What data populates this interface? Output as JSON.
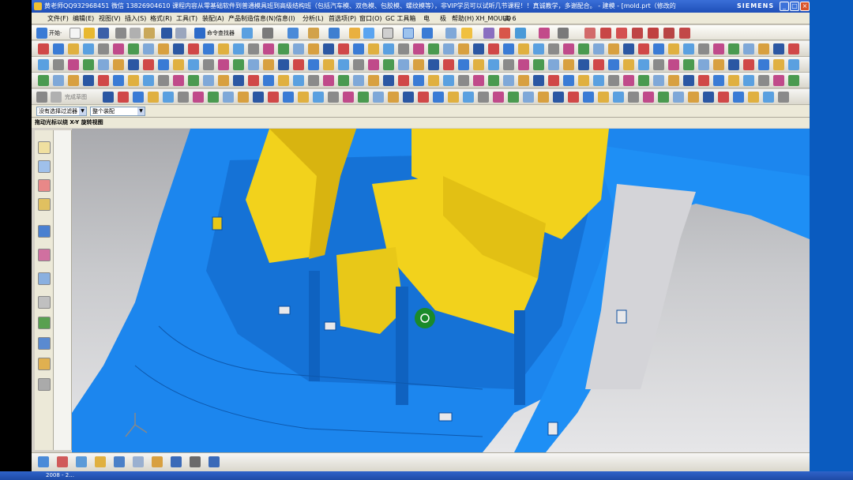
{
  "window": {
    "title": "黄老师QQ932968451 微信 13826904610 课程内容从零基础软件到普通模具班到高级结构班（包括汽车模、双色模、包胶模、螺纹模等），非VIP学员可以试听几节课程！！真诚教学，多谢配合。 - 建模 - [mold.prt（修改的）]",
    "brand": "SIEMENS",
    "buttons": [
      "_",
      "□",
      "×"
    ]
  },
  "menu": [
    "文件(F)",
    "编辑(E)",
    "视图(V)",
    "插入(S)",
    "格式(R)",
    "工具(T)",
    "装配(A)",
    "产品制造信息(N)",
    "信息(I)",
    "分析(L)",
    "首选项(P)",
    "窗口(O)",
    "GC 工具箱",
    "电",
    "极",
    "帮助(H)",
    "XH_MOULD",
    "高 6"
  ],
  "toolbar_labels": {
    "start": "开始·",
    "command_finder": "命令查找器",
    "finish_sketch": "完成草图"
  },
  "selection": {
    "filter": "没有选择过滤器",
    "scope": "整个装配"
  },
  "cue_line": "拖动光标以绕 X-Y 旋转视图",
  "taskbar_text": "2008 - 2...",
  "colors": {
    "part_blue": "#1f8ff0",
    "insert_yellow": "#f2d21c",
    "background_top": "#a9aaae",
    "title_blue": "#2a5fcc",
    "rotate_marker": "#1a8a2a"
  },
  "view": {
    "rotate_icon": "rotate-cursor-icon",
    "triad": "wcs-triad-icon"
  }
}
